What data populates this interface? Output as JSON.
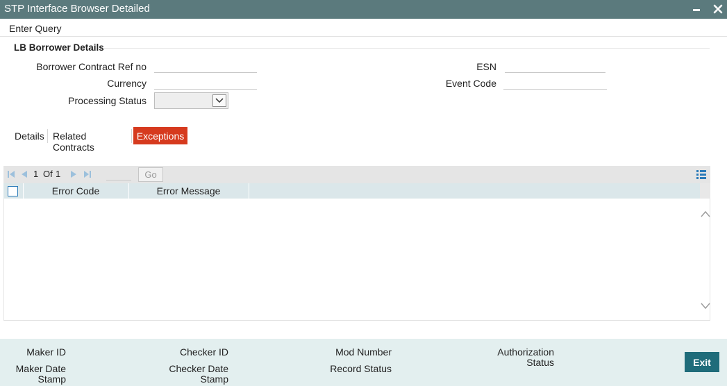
{
  "window": {
    "title": "STP Interface Browser Detailed",
    "minimize": "-",
    "close": "×"
  },
  "menu": {
    "enter_query": "Enter Query"
  },
  "section": {
    "title": "LB Borrower Details"
  },
  "fields": {
    "borrower_contract_ref_no": {
      "label": "Borrower Contract Ref no",
      "value": ""
    },
    "currency": {
      "label": "Currency",
      "value": ""
    },
    "processing_status": {
      "label": "Processing Status",
      "value": ""
    },
    "esn": {
      "label": "ESN",
      "value": ""
    },
    "event_code": {
      "label": "Event Code",
      "value": ""
    }
  },
  "tabs": [
    {
      "label": "Details",
      "active": false
    },
    {
      "label": "Related Contracts",
      "active": false
    },
    {
      "label": "Exceptions",
      "active": true
    }
  ],
  "grid": {
    "pagination": {
      "current": "1",
      "of_label": "Of",
      "total": "1",
      "go_label": "Go"
    },
    "columns": [
      "Error Code",
      "Error Message"
    ],
    "rows": []
  },
  "footer": {
    "maker_id": "Maker ID",
    "maker_date_stamp_1": "Maker Date",
    "maker_date_stamp_2": "Stamp",
    "checker_id": "Checker ID",
    "checker_date_stamp_1": "Checker Date",
    "checker_date_stamp_2": "Stamp",
    "mod_number": "Mod Number",
    "record_status": "Record Status",
    "authorization_status_1": "Authorization",
    "authorization_status_2": "Status",
    "exit_label": "Exit"
  },
  "colors": {
    "titlebar": "#5b7a7d",
    "active_tab": "#d63a1e",
    "exit_button": "#1f6c7a",
    "footer": "#e3efef",
    "grid_header": "#dbe7ea"
  }
}
